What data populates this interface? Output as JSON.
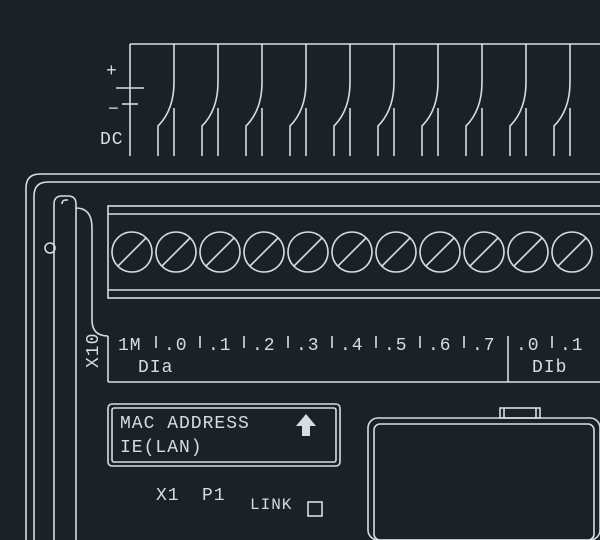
{
  "power": {
    "plus": "+",
    "minus": "−",
    "dc": "DC"
  },
  "terminals": {
    "row_label_left": "X10",
    "header_1M": "1M",
    "pins": [
      ".0",
      ".1",
      ".2",
      ".3",
      ".4",
      ".5",
      ".6",
      ".7",
      ".0",
      ".1"
    ],
    "group_a": "DIa",
    "group_b": "DIb"
  },
  "plate": {
    "line1": "MAC ADDRESS",
    "line2": "IE(LAN)"
  },
  "bottom": {
    "x1": "X1",
    "p1": "P1",
    "link": "LINK"
  }
}
